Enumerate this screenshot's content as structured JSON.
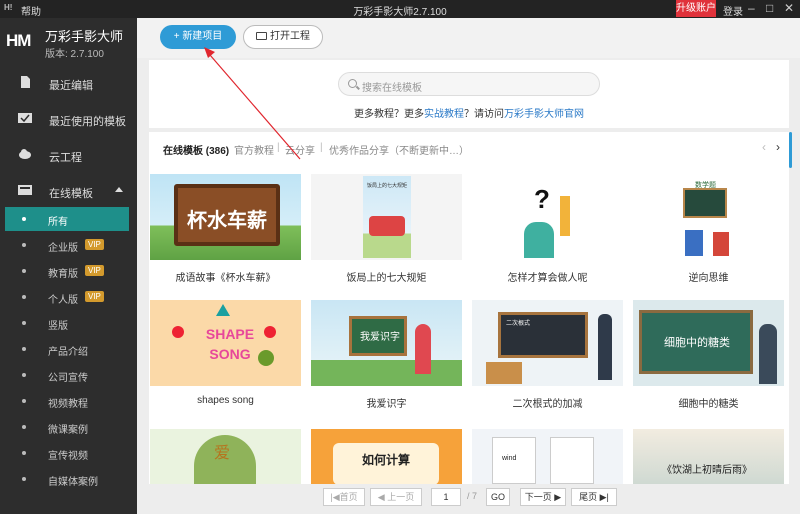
{
  "titlebar": {
    "app_icon": "H!",
    "help": "帮助",
    "title": "万彩手影大师2.7.100",
    "upgrade": "升级账户",
    "login": "登录",
    "minimize": "–",
    "maximize": "□",
    "close": "✕"
  },
  "brand": {
    "logo": "HM",
    "name": "万彩手影大师",
    "version": "版本: 2.7.100"
  },
  "sidebar": {
    "items": [
      {
        "label": "最近编辑",
        "icon": "document-icon"
      },
      {
        "label": "最近使用的模板",
        "icon": "check-icon"
      },
      {
        "label": "云工程",
        "icon": "cloud-icon"
      },
      {
        "label": "在线模板",
        "icon": "template-icon"
      }
    ],
    "sub_items": [
      {
        "label": "所有",
        "vip": ""
      },
      {
        "label": "企业版",
        "vip": "VIP"
      },
      {
        "label": "教育版",
        "vip": "VIP"
      },
      {
        "label": "个人版",
        "vip": "VIP"
      },
      {
        "label": "竖版",
        "vip": ""
      },
      {
        "label": "产品介绍",
        "vip": ""
      },
      {
        "label": "公司宣传",
        "vip": ""
      },
      {
        "label": "视频教程",
        "vip": ""
      },
      {
        "label": "微课案例",
        "vip": ""
      },
      {
        "label": "宣传视频",
        "vip": ""
      },
      {
        "label": "自媒体案例",
        "vip": ""
      }
    ]
  },
  "toolbar": {
    "new_project": "新建项目",
    "open_project": "打开工程"
  },
  "search": {
    "placeholder": "搜索在线模板",
    "tip_prefix": "更多教程？更多",
    "tip_link1": "实战教程",
    "tip_middle": "？请访问",
    "tip_link2": "万彩手影大师官网"
  },
  "tabs": {
    "online": "在线模板 (386)",
    "official": "官方教程",
    "cloud": "云分享",
    "works": "优秀作品分享（不断更新中…）"
  },
  "cards": [
    {
      "caption": "成语故事《杯水车薪》",
      "thumb_text": "杯水车薪"
    },
    {
      "caption": "饭局上的七大规矩",
      "thumb_text": "饭局上的七大规矩"
    },
    {
      "caption": "怎样才算会做人呢",
      "thumb_text": "?"
    },
    {
      "caption": "逆向思维",
      "thumb_text": "数学题"
    },
    {
      "caption": "shapes song",
      "thumb_text": "SHAPE SONG"
    },
    {
      "caption": "我爱识字",
      "thumb_text": "我爱识字"
    },
    {
      "caption": "二次根式的加减",
      "thumb_text": "二次根式"
    },
    {
      "caption": "细胞中的糖类",
      "thumb_text": "细胞中的糖类"
    },
    {
      "caption": "",
      "thumb_text": "爱"
    },
    {
      "caption": "",
      "thumb_text": "如何计算"
    },
    {
      "caption": "",
      "thumb_text": "wind"
    },
    {
      "caption": "",
      "thumb_text": "《饮湖上初晴后雨》"
    }
  ],
  "pager": {
    "first": "|◀首页",
    "prev": "◀ 上一页",
    "page": "1",
    "total": "/ 7",
    "go": "GO",
    "next": "下一页 ▶",
    "last": "尾页 ▶|"
  }
}
